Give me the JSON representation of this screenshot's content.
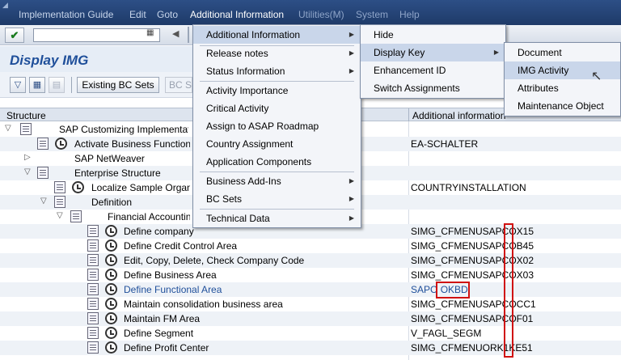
{
  "menubar": {
    "items": [
      "Implementation Guide",
      "Edit",
      "Goto",
      "Additional Information",
      "Utilities(M)",
      "System",
      "Help"
    ]
  },
  "toolbar": {
    "ok_icon": "check-icon",
    "command_field_value": ""
  },
  "title": "Display IMG",
  "app_toolbar": {
    "existing_bc_sets_label": "Existing BC Sets",
    "bc_sets_activity_label": "BC Sets for Activity"
  },
  "tree_header": {
    "structure": "Structure",
    "additional_information": "Additional information"
  },
  "tree_rows": [
    {
      "label": "SAP Customizing Implementation Guide",
      "info": ""
    },
    {
      "label": "Activate Business Functions",
      "info": "EA-SCHALTER"
    },
    {
      "label": "SAP NetWeaver",
      "info": ""
    },
    {
      "label": "Enterprise Structure",
      "info": ""
    },
    {
      "label": "Localize Sample Organizational Units",
      "info": "COUNTRYINSTALLATION"
    },
    {
      "label": "Definition",
      "info": ""
    },
    {
      "label": "Financial Accounting",
      "info": ""
    },
    {
      "label": "Define company",
      "info": "SIMG_CFMENUSAPCOX15"
    },
    {
      "label": "Define Credit Control Area",
      "info": "SIMG_CFMENUSAPCOB45"
    },
    {
      "label": "Edit, Copy, Delete, Check Company Code",
      "info": "SIMG_CFMENUSAPCOX02"
    },
    {
      "label": "Define Business Area",
      "info": "SIMG_CFMENUSAPCOX03"
    },
    {
      "label": "Define Functional Area",
      "info_prefix": "SAPC",
      "info_code": "OKBD"
    },
    {
      "label": "Maintain consolidation business area",
      "info": "SIMG_CFMENUSAPCOCC1"
    },
    {
      "label": "Maintain FM Area",
      "info": "SIMG_CFMENUSAPCOF01"
    },
    {
      "label": "Define Segment",
      "info": "V_FAGL_SEGM"
    },
    {
      "label": "Define Profit Center",
      "info": "SIMG_CFMENUORK1KE51"
    }
  ],
  "menu_main": {
    "items": [
      {
        "label": "Additional Information",
        "submenu": true
      },
      {
        "label": "Release notes",
        "submenu": true
      },
      {
        "label": "Status Information",
        "submenu": true
      },
      {
        "label": "Activity Importance",
        "submenu": false
      },
      {
        "label": "Critical Activity",
        "submenu": false
      },
      {
        "label": "Assign to ASAP Roadmap",
        "submenu": false
      },
      {
        "label": "Country Assignment",
        "submenu": false
      },
      {
        "label": "Application Components",
        "submenu": false
      },
      {
        "label": "Business Add-Ins",
        "submenu": true
      },
      {
        "label": "BC Sets",
        "submenu": true
      },
      {
        "label": "Technical Data",
        "submenu": true
      }
    ]
  },
  "menu_sub1": {
    "items": [
      {
        "label": "Hide",
        "submenu": false
      },
      {
        "label": "Display Key",
        "submenu": true
      },
      {
        "label": "Enhancement ID",
        "submenu": false
      },
      {
        "label": "Switch Assignments",
        "submenu": false
      }
    ]
  },
  "menu_sub2": {
    "items": [
      {
        "label": "Document"
      },
      {
        "label": "IMG Activity"
      },
      {
        "label": "Attributes"
      },
      {
        "label": "Maintenance Object"
      }
    ]
  },
  "colors": {
    "menubar_bg": "#1e3a68",
    "title_color": "#1f4f9a",
    "highlight_red": "#d01010",
    "menu_selected": "#c9d6ea"
  }
}
